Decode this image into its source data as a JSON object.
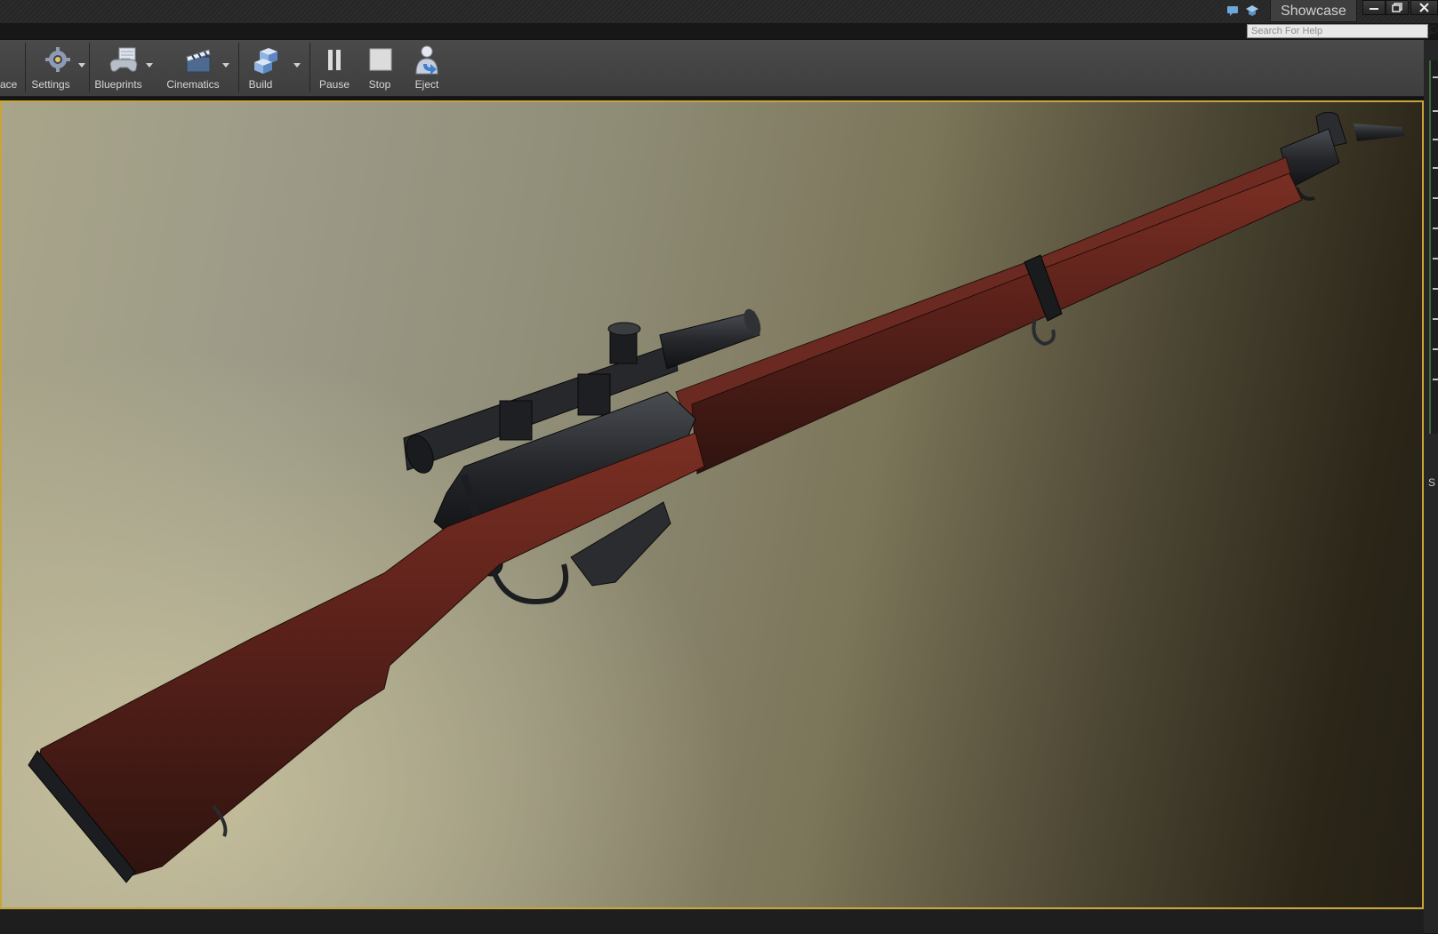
{
  "window": {
    "project_tab": "Showcase",
    "controls": [
      "minimize",
      "restore",
      "close"
    ]
  },
  "help": {
    "search_placeholder": "Search For Help"
  },
  "toolbar": {
    "buttons": [
      {
        "label": "ace",
        "icon": "marketplace-icon",
        "dropdown": false
      },
      {
        "label": "Settings",
        "icon": "settings-icon",
        "dropdown": true
      },
      {
        "label": "Blueprints",
        "icon": "blueprints-icon",
        "dropdown": true
      },
      {
        "label": "Cinematics",
        "icon": "cinematics-icon",
        "dropdown": true
      },
      {
        "label": "Build",
        "icon": "build-icon",
        "dropdown": true
      },
      {
        "label": "Pause",
        "icon": "pause-icon",
        "dropdown": false
      },
      {
        "label": "Stop",
        "icon": "stop-icon",
        "dropdown": false
      },
      {
        "label": "Eject",
        "icon": "eject-icon",
        "dropdown": false
      }
    ]
  },
  "viewport": {
    "content": "rifle-model",
    "border_color": "#c9a436"
  },
  "side_panel": {
    "visible_letter": "S"
  }
}
